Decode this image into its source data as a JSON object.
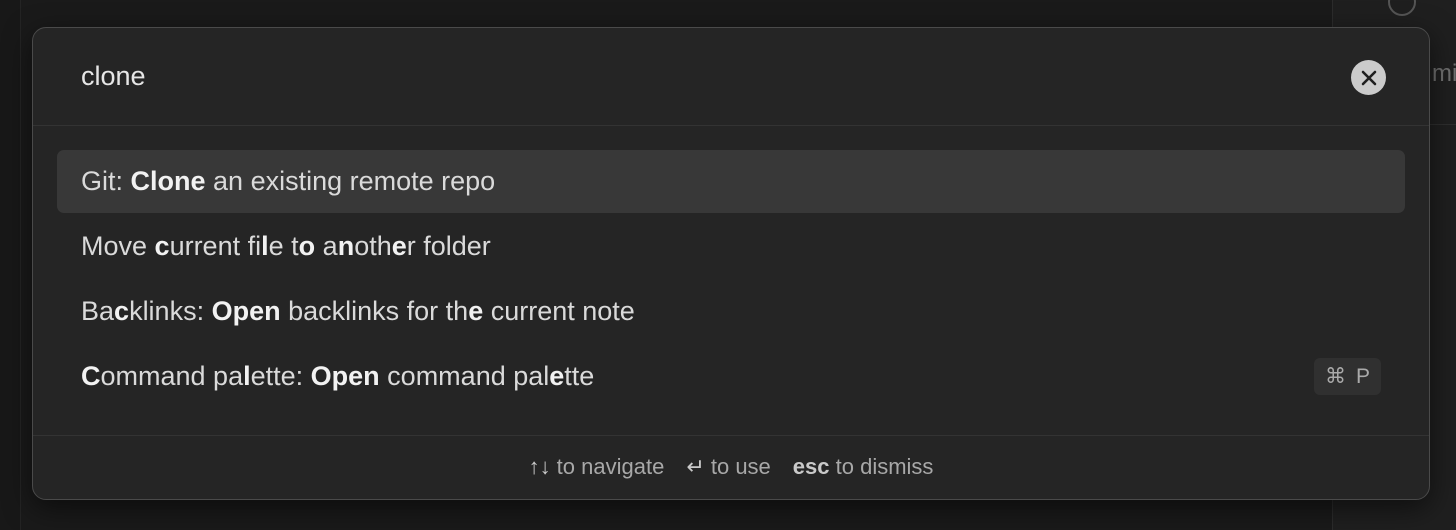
{
  "background": {
    "right_pane_text": "mi"
  },
  "prompt": {
    "query": "clone",
    "clear_icon": "close-icon"
  },
  "suggestions": [
    {
      "selected": true,
      "parts": [
        {
          "text": "Git: ",
          "bold": false
        },
        {
          "text": "Clone",
          "bold": true
        },
        {
          "text": " an existing remote repo",
          "bold": false
        }
      ]
    },
    {
      "selected": false,
      "parts": [
        {
          "text": "Move ",
          "bold": false
        },
        {
          "text": "c",
          "bold": true
        },
        {
          "text": "urrent fi",
          "bold": false
        },
        {
          "text": "l",
          "bold": true
        },
        {
          "text": "e t",
          "bold": false
        },
        {
          "text": "o",
          "bold": true
        },
        {
          "text": " a",
          "bold": false
        },
        {
          "text": "n",
          "bold": true
        },
        {
          "text": "oth",
          "bold": false
        },
        {
          "text": "e",
          "bold": true
        },
        {
          "text": "r folder",
          "bold": false
        }
      ]
    },
    {
      "selected": false,
      "parts": [
        {
          "text": "Ba",
          "bold": false
        },
        {
          "text": "c",
          "bold": true
        },
        {
          "text": "klinks: ",
          "bold": false
        },
        {
          "text": "Open",
          "bold": true
        },
        {
          "text": " backlinks for th",
          "bold": false
        },
        {
          "text": "e",
          "bold": true
        },
        {
          "text": " current note",
          "bold": false
        }
      ]
    },
    {
      "selected": false,
      "parts": [
        {
          "text": "C",
          "bold": true
        },
        {
          "text": "ommand pa",
          "bold": false
        },
        {
          "text": "l",
          "bold": true
        },
        {
          "text": "ette: ",
          "bold": false
        },
        {
          "text": "Open",
          "bold": true
        },
        {
          "text": " command pal",
          "bold": false
        },
        {
          "text": "e",
          "bold": true
        },
        {
          "text": "tte",
          "bold": false
        }
      ],
      "hotkey": [
        "⌘",
        "P"
      ]
    }
  ],
  "footer": {
    "instructions": [
      {
        "key": "↑↓",
        "key_bold": false,
        "text": "to navigate"
      },
      {
        "key": "↵",
        "key_bold": false,
        "text": "to use"
      },
      {
        "key": "esc",
        "key_bold": true,
        "text": "to dismiss"
      }
    ]
  }
}
